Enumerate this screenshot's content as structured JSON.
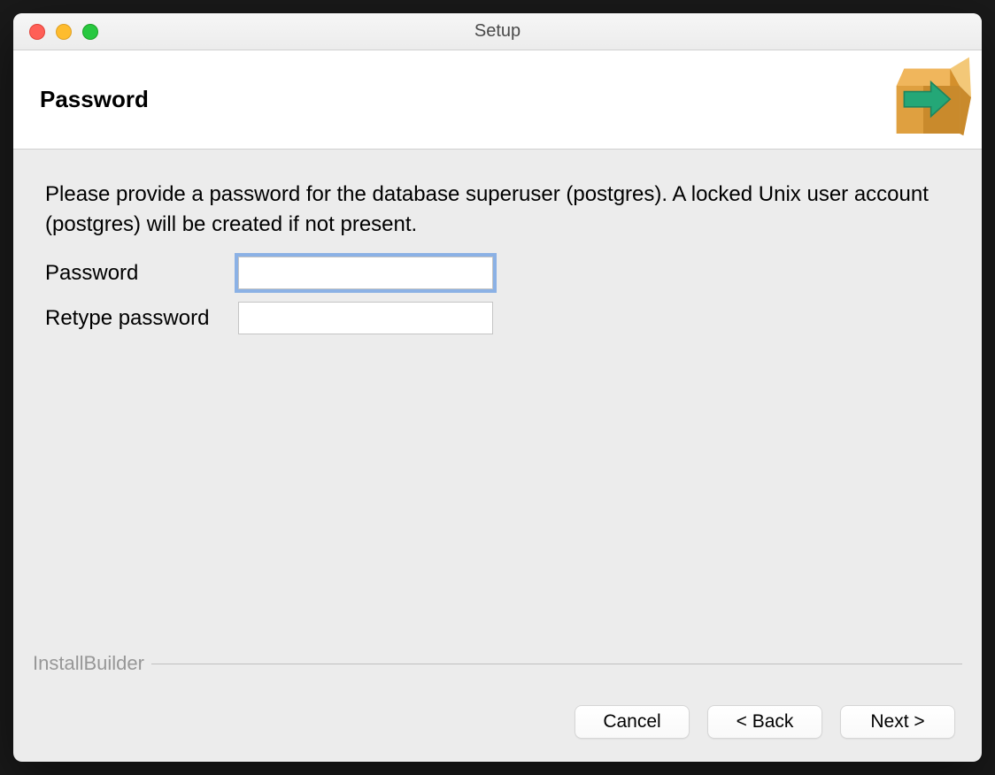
{
  "window": {
    "title": "Setup"
  },
  "header": {
    "title": "Password"
  },
  "content": {
    "instruction": "Please provide a password for the database superuser (postgres). A locked Unix user account (postgres) will be created if not present.",
    "password_label": "Password",
    "retype_label": "Retype password",
    "password_value": "",
    "retype_value": ""
  },
  "footer": {
    "brand": "InstallBuilder",
    "cancel_label": "Cancel",
    "back_label": "< Back",
    "next_label": "Next >"
  }
}
